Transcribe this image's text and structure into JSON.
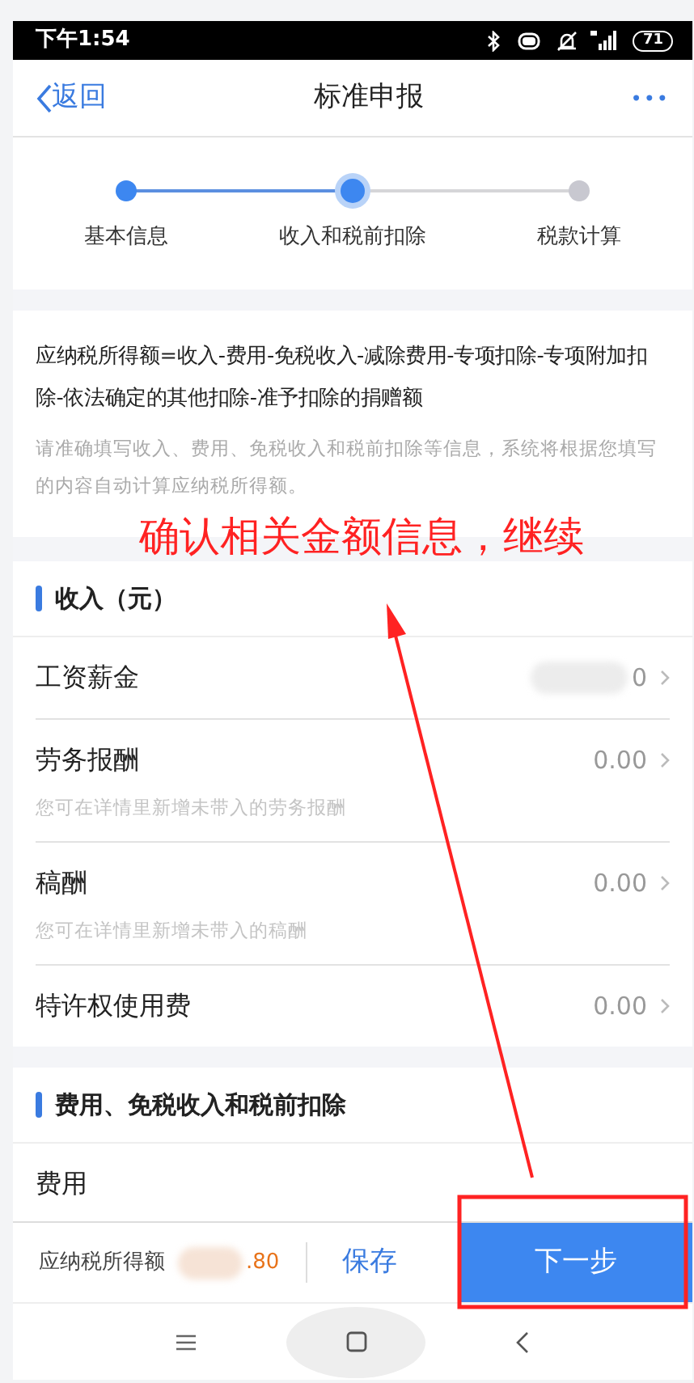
{
  "status_bar": {
    "time": "下午1:54",
    "battery": "71"
  },
  "nav": {
    "back": "返回",
    "title": "标准申报",
    "more": "•••"
  },
  "steps": [
    {
      "label": "基本信息",
      "completed": true,
      "selected": false
    },
    {
      "label": "收入和税前扣除",
      "completed": false,
      "selected": true
    },
    {
      "label": "税款计算",
      "completed": false,
      "selected": false
    }
  ],
  "formula": {
    "text": "应纳税所得额=收入-费用-免税收入-减除费用-专项扣除-专项附加扣除-依法确定的其他扣除-准予扣除的捐赠额",
    "hint": "请准确填写收入、费用、免税收入和税前扣除等信息，系统将根据您填写的内容自动计算应纳税所得额。"
  },
  "sections": [
    {
      "title": "收入（元）",
      "rows": [
        {
          "label": "工资薪金",
          "value": "0",
          "blurred": true
        },
        {
          "label": "劳务报酬",
          "value": "0.00",
          "hint": "您可在详情里新增未带入的劳务报酬"
        },
        {
          "label": "稿酬",
          "value": "0.00",
          "hint": "您可在详情里新增未带入的稿酬"
        },
        {
          "label": "特许权使用费",
          "value": "0.00"
        }
      ]
    },
    {
      "title": "费用、免税收入和税前扣除",
      "rows": [
        {
          "label": "费用"
        }
      ]
    }
  ],
  "bottom_bar": {
    "label": "应纳税所得额",
    "amount": ".80",
    "save": "保存",
    "next": "下一步"
  },
  "annotation": {
    "text": "确认相关金额信息，继续"
  }
}
